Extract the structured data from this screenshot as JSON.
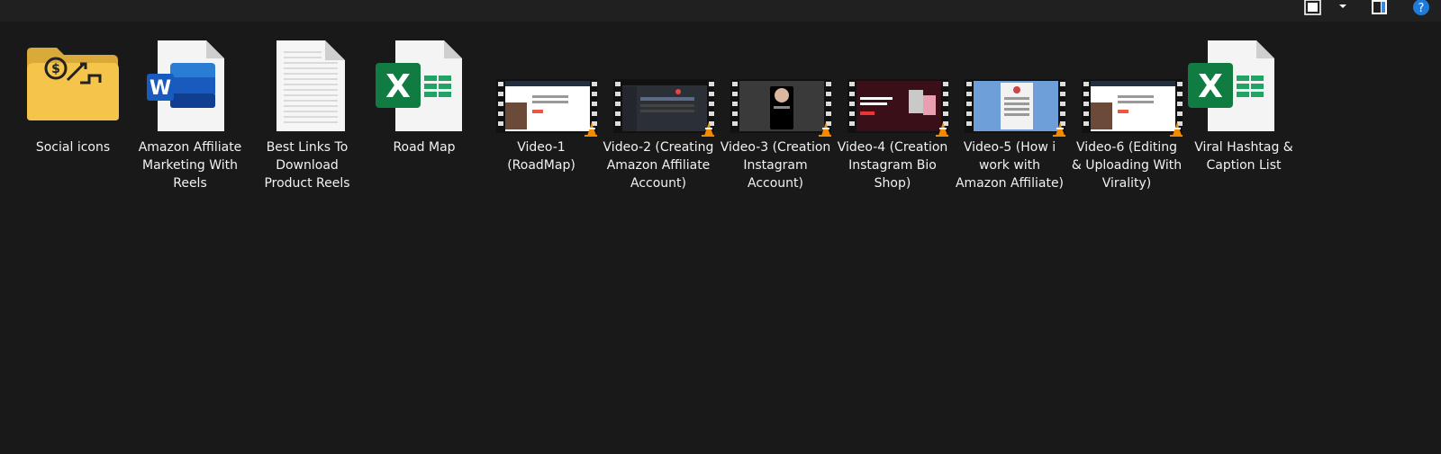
{
  "toolbar": {
    "icons": [
      "layout-icon",
      "chevron-down-icon",
      "details-pane-icon",
      "help-icon"
    ],
    "help_glyph": "?"
  },
  "colors": {
    "background": "#191919",
    "folder": "#f4c54a",
    "word_blue": "#185abd",
    "excel_green": "#107c41",
    "vlc_orange": "#f48a00"
  },
  "items": [
    {
      "name": "Social icons",
      "kind": "folder"
    },
    {
      "name": "Amazon Affiliate Marketing With Reels",
      "kind": "word",
      "badge": "W"
    },
    {
      "name": "Best Links To Download Product Reels",
      "kind": "text"
    },
    {
      "name": "Road Map",
      "kind": "excel",
      "badge": "X"
    },
    {
      "name": "Video-1 (RoadMap)",
      "kind": "video"
    },
    {
      "name": "Video-2 (Creating Amazon Affiliate Account)",
      "kind": "video"
    },
    {
      "name": "Video-3 (Creation Instagram Account)",
      "kind": "video"
    },
    {
      "name": "Video-4 (Creation Instagram Bio Shop)",
      "kind": "video"
    },
    {
      "name": "Video-5 (How i work with Amazon Affiliate)",
      "kind": "video"
    },
    {
      "name": "Video-6 (Editing & Uploading With Virality)",
      "kind": "video"
    },
    {
      "name": "Viral Hashtag & Caption List",
      "kind": "excel",
      "badge": "X"
    }
  ]
}
